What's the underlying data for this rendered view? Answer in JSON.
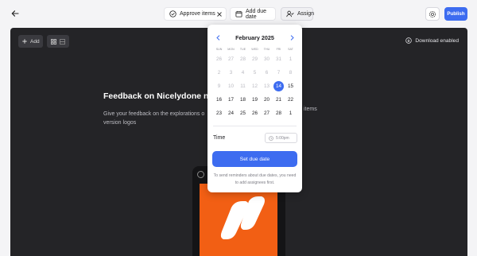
{
  "toolbar": {
    "approve_label": "Approve items",
    "due_label": "Add due date",
    "assign_label": "Assign",
    "publish_label": "Publish",
    "icons": {
      "back": "arrow-left-icon",
      "approve": "check-circle-icon",
      "close": "close-icon",
      "due": "calendar-icon",
      "assign": "user-check-icon",
      "settings": "gear-icon"
    }
  },
  "canvas": {
    "add_label": "Add",
    "download_label": "Download enabled",
    "heading": "Feedback on Nicelydone new",
    "description": "Give your feedback on the explorations o",
    "description_line2": "version logos",
    "description_tail": "items"
  },
  "calendar": {
    "month_label": "February 2025",
    "weekdays": [
      "SUN",
      "MON",
      "TUE",
      "WED",
      "THU",
      "FRI",
      "SAT"
    ],
    "weeks": [
      [
        {
          "d": "26",
          "m": true
        },
        {
          "d": "27",
          "m": true
        },
        {
          "d": "28",
          "m": true
        },
        {
          "d": "29",
          "m": true
        },
        {
          "d": "30",
          "m": true
        },
        {
          "d": "31",
          "m": true
        },
        {
          "d": "1",
          "m": true
        }
      ],
      [
        {
          "d": "2",
          "m": true
        },
        {
          "d": "3",
          "m": true
        },
        {
          "d": "4",
          "m": true
        },
        {
          "d": "5",
          "m": true
        },
        {
          "d": "6",
          "m": true
        },
        {
          "d": "7",
          "m": true
        },
        {
          "d": "8",
          "m": true
        }
      ],
      [
        {
          "d": "9",
          "m": true
        },
        {
          "d": "10",
          "m": true
        },
        {
          "d": "11",
          "m": true
        },
        {
          "d": "12",
          "m": true
        },
        {
          "d": "13",
          "m": true
        },
        {
          "d": "14",
          "s": true
        },
        {
          "d": "15"
        }
      ],
      [
        {
          "d": "16"
        },
        {
          "d": "17"
        },
        {
          "d": "18"
        },
        {
          "d": "19"
        },
        {
          "d": "20"
        },
        {
          "d": "21"
        },
        {
          "d": "22"
        }
      ],
      [
        {
          "d": "23"
        },
        {
          "d": "24"
        },
        {
          "d": "25"
        },
        {
          "d": "26"
        },
        {
          "d": "27"
        },
        {
          "d": "28"
        },
        {
          "d": "1"
        }
      ]
    ],
    "time_label": "Time",
    "time_placeholder": "5:00pm",
    "set_label": "Set due date",
    "note": "To send reminders about due dates, you need to add assignees first."
  },
  "colors": {
    "accent": "#3d6cf0",
    "canvas_bg": "#242427",
    "preview_orange": "#f25f14"
  }
}
